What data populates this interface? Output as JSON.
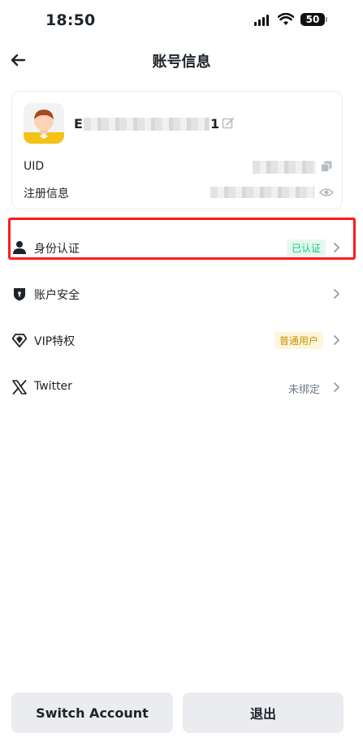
{
  "status_bar": {
    "time": "18:50",
    "battery": "50"
  },
  "header": {
    "title": "账号信息"
  },
  "profile": {
    "username_prefix": "E",
    "username_suffix": "1",
    "uid_label": "UID",
    "register_label": "注册信息"
  },
  "menu": {
    "identity": {
      "label": "身份认证",
      "status": "已认证"
    },
    "security": {
      "label": "账户安全"
    },
    "vip": {
      "label": "VIP特权",
      "status": "普通用户"
    },
    "twitter": {
      "label": "Twitter",
      "status": "未绑定"
    }
  },
  "buttons": {
    "switch": "Switch Account",
    "logout": "退出"
  },
  "colors": {
    "accent_green_text": "#0ecb81",
    "accent_green_bg": "#e7f8f0",
    "vip_text": "#c99400",
    "vip_bg": "#fdf6dd",
    "highlight_red": "#ff1a1a"
  }
}
